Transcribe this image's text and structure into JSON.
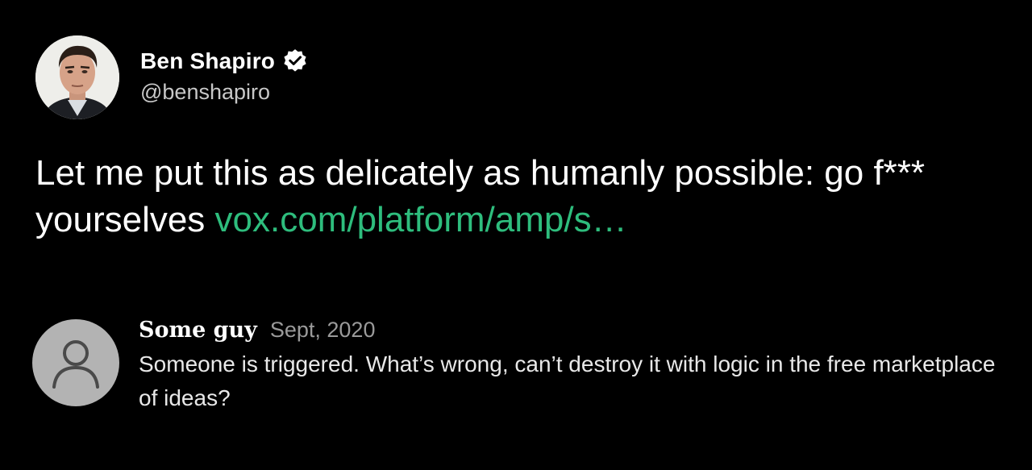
{
  "tweet": {
    "author_name": "Ben Shapiro",
    "author_handle": "@benshapiro",
    "verified_icon": "verified-badge-icon",
    "text": "Let me put this as delicately as humanly possible: go f*** yourselves ",
    "link_text": "vox.com/platform/amp/s…"
  },
  "reply": {
    "author_name": "Some guy",
    "date": "Sept, 2020",
    "text": "Someone is triggered. What’s wrong, can’t destroy it with logic in the free marketplace of ideas?",
    "avatar_icon": "default-user-icon"
  },
  "colors": {
    "background": "#000000",
    "link": "#2ebd7d",
    "name": "#ffffff",
    "handle": "#c8c8c8",
    "date": "#9a9a9a",
    "reply_avatar_bg": "#b3b3b3"
  }
}
